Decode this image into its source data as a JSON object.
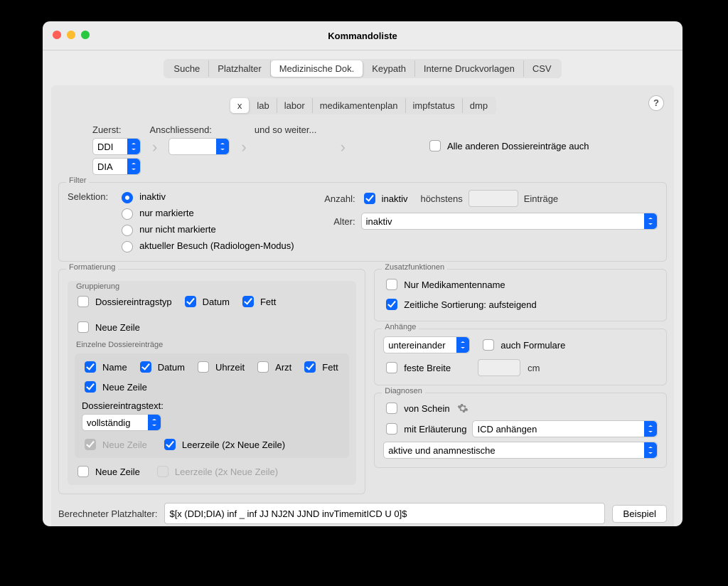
{
  "window": {
    "title": "Kommandoliste"
  },
  "tabs": {
    "items": [
      "Suche",
      "Platzhalter",
      "Medizinische Dok.",
      "Keypath",
      "Interne Druckvorlagen",
      "CSV"
    ],
    "active": 2
  },
  "subtabs": {
    "items": [
      "x",
      "lab",
      "labor",
      "medikamentenplan",
      "impfstatus",
      "dmp"
    ],
    "active": 0
  },
  "sequence": {
    "first_label": "Zuerst:",
    "then_label": "Anschliessend:",
    "more_label": "und so weiter...",
    "first_a": "DDI",
    "first_b": "DIA",
    "then": "",
    "all_other": "Alle anderen Dossiereinträge auch"
  },
  "filter": {
    "title": "Filter",
    "selection_label": "Selektion:",
    "opts": {
      "inaktiv": "inaktiv",
      "nur_markierte": "nur markierte",
      "nur_nicht_markierte": "nur nicht markierte",
      "aktueller_besuch": "aktueller Besuch (Radiologen-Modus)"
    },
    "anzahl_label": "Anzahl:",
    "anzahl_inaktiv": "inaktiv",
    "hoechstens": "höchstens",
    "eintraege": "Einträge",
    "alter_label": "Alter:",
    "alter_val": "inaktiv"
  },
  "formatierung": {
    "title": "Formatierung",
    "gruppierung_title": "Gruppierung",
    "grp": {
      "dossiereintragstyp": "Dossiereintragstyp",
      "datum": "Datum",
      "fett": "Fett",
      "neue_zeile": "Neue Zeile"
    },
    "entries_title": "Einzelne Dossiereinträge",
    "entries": {
      "name": "Name",
      "datum": "Datum",
      "uhrzeit": "Uhrzeit",
      "arzt": "Arzt",
      "fett": "Fett",
      "neue_zeile": "Neue Zeile"
    },
    "dossiereintragstext": "Dossiereintragstext:",
    "dossier_text_val": "vollständig",
    "neue_zeile_dim": "Neue Zeile",
    "leerzeile": "Leerzeile (2x Neue Zeile)",
    "outer_neue_zeile": "Neue Zeile",
    "outer_leerzeile": "Leerzeile (2x Neue Zeile)"
  },
  "zusatz": {
    "title": "Zusatzfunktionen",
    "nur_med": "Nur Medikamentenname",
    "sort": "Zeitliche Sortierung: aufsteigend"
  },
  "anhaenge": {
    "title": "Anhänge",
    "untereinander": "untereinander",
    "auch_formulare": "auch Formulare",
    "feste_breite": "feste Breite",
    "cm": "cm"
  },
  "diagnosen": {
    "title": "Diagnosen",
    "von_schein": "von Schein",
    "mit_erl": "mit Erläuterung",
    "icd": "ICD anhängen",
    "aktive": "aktive und anamnestische"
  },
  "footer": {
    "label": "Berechneter Platzhalter:",
    "value": "$[x (DDI;DIA) inf _ inf JJ NJ2N JJND invTimemitICD U 0]$",
    "button": "Beispiel"
  },
  "help": "?"
}
